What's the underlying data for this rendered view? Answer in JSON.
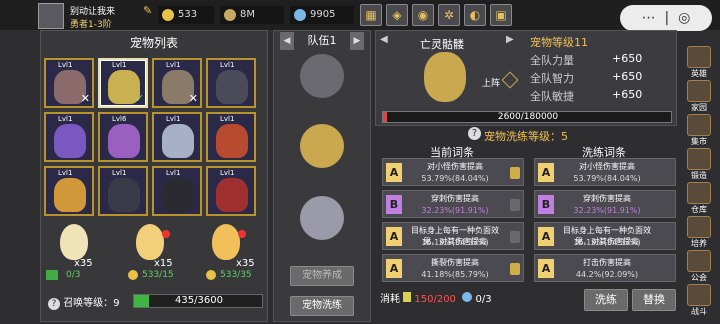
{
  "player": {
    "name": "别动让我来",
    "rank": "勇者1-3阶"
  },
  "resources": [
    {
      "icon": "coin-icon",
      "value": "533",
      "color": "#e9c146"
    },
    {
      "icon": "money-icon",
      "value": "8M",
      "color": "#c9a860"
    },
    {
      "icon": "diamond-icon",
      "value": "9905",
      "color": "#7db7e8"
    }
  ],
  "top_icons": [
    "shop-icon",
    "gift-icon",
    "game-pad-icon",
    "settings-icon",
    "event-icon",
    "chest-icon"
  ],
  "pet_list": {
    "title": "宠物列表",
    "pets": [
      {
        "level": "Lvl1",
        "color": "#8a6a6a",
        "mark": "✕"
      },
      {
        "level": "Lvl1",
        "color": "#c9b050",
        "mark": "✓",
        "selected": true
      },
      {
        "level": "Lvl1",
        "color": "#8c7a68",
        "mark": "✕"
      },
      {
        "level": "Lvl1",
        "color": "#4a4a58",
        "mark": ""
      },
      {
        "level": "Lvl1",
        "color": "#7a58c0",
        "mark": ""
      },
      {
        "level": "Lvl6",
        "color": "#9a60c0",
        "mark": ""
      },
      {
        "level": "Lvl1",
        "color": "#a8b0c8",
        "mark": ""
      },
      {
        "level": "Lvl1",
        "color": "#b84a30",
        "mark": ""
      },
      {
        "level": "Lvl1",
        "color": "#d09838",
        "mark": ""
      },
      {
        "level": "Lvl1",
        "color": "#3a3a48",
        "mark": ""
      },
      {
        "level": "Lvl1",
        "color": "#2a2a30",
        "mark": ""
      },
      {
        "level": "Lvl1",
        "color": "#a03030",
        "mark": ""
      }
    ]
  },
  "eggs": [
    {
      "count": "x35",
      "cost": "0/3",
      "cost_color": "#5fd060"
    },
    {
      "count": "x15",
      "cost": "533/15",
      "cost_color": "#5fd060"
    },
    {
      "count": "x35",
      "cost": "533/35",
      "cost_color": "#5fd060"
    }
  ],
  "summon": {
    "label": "召唤等级：",
    "level": "9",
    "progress": "435/3600",
    "fraction": 0.1208
  },
  "team": {
    "tab": "队伍1",
    "slots": [
      {
        "color": "#6a6a70"
      },
      {
        "color": "#c9a850"
      },
      {
        "color": "#9a9aa8"
      }
    ],
    "pet_summon_btn": "宠物养成",
    "pet_wash_btn": "宠物洗练"
  },
  "detail": {
    "name": "亡灵骷髅",
    "level": "宠物等级11",
    "deploy_label": "上阵",
    "stats": [
      {
        "label": "全队力量",
        "value": "+650"
      },
      {
        "label": "全队智力",
        "value": "+650"
      },
      {
        "label": "全队敏捷",
        "value": "+650"
      }
    ],
    "exp": "2600/180000",
    "exp_fraction": 0.0144
  },
  "wash": {
    "level_label": "宠物洗练等级：",
    "level": "5",
    "current_head": "当前词条",
    "wash_head": "洗练词条",
    "current": [
      {
        "tag": "A",
        "tag_color": "#f0d070",
        "name": "对小怪伤害提高",
        "value": "53.79%(84.04%)",
        "locked": true
      },
      {
        "tag": "B",
        "tag_color": "#c080e0",
        "name": "穿刺伤害提高",
        "value": "32.23%(91.91%)",
        "locked": false
      },
      {
        "tag": "A",
        "tag_color": "#f0d070",
        "name": "目标身上每有一种负面效果，对其伤害提高",
        "value": "16.19%(84.33%)",
        "locked": false
      },
      {
        "tag": "A",
        "tag_color": "#f0d070",
        "name": "撕裂伤害提高",
        "value": "41.18%(85.79%)",
        "locked": true
      }
    ],
    "wash": [
      {
        "tag": "A",
        "tag_color": "#f0d070",
        "name": "对小怪伤害提高",
        "value": "53.79%(84.04%)"
      },
      {
        "tag": "B",
        "tag_color": "#c080e0",
        "name": "穿刺伤害提高",
        "value": "32.23%(91.91%)"
      },
      {
        "tag": "A",
        "tag_color": "#f0d070",
        "name": "目标身上每有一种负面效果，对其伤害提高",
        "value": "16.19%(84.33%)"
      },
      {
        "tag": "A",
        "tag_color": "#f0d070",
        "name": "打击伤害提高",
        "value": "44.2%(92.09%)"
      }
    ],
    "cost_label": "消耗",
    "cost1": "150/200",
    "cost2": "0/3",
    "wash_btn": "洗练",
    "replace_btn": "替换"
  },
  "side_menu": [
    {
      "label": "英雄",
      "icon": "hero-icon"
    },
    {
      "label": "家园",
      "icon": "home-icon"
    },
    {
      "label": "集市",
      "icon": "market-icon"
    },
    {
      "label": "锻造",
      "icon": "forge-icon"
    },
    {
      "label": "仓库",
      "icon": "warehouse-icon"
    },
    {
      "label": "培养",
      "icon": "train-icon"
    },
    {
      "label": "公会",
      "icon": "guild-icon"
    },
    {
      "label": "战斗",
      "icon": "battle-icon"
    }
  ]
}
